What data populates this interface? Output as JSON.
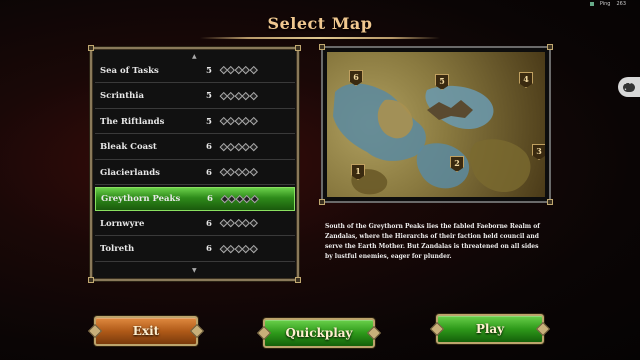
{
  "header": {
    "title": "Select Map",
    "ping_label": "Ping",
    "ping_value": "263"
  },
  "map_list": {
    "scroll_up_icon": "▲",
    "scroll_down_icon": "▼",
    "rows": [
      {
        "name": "Sea of Tasks",
        "players": "5",
        "rating": 5,
        "selected": false
      },
      {
        "name": "Scrinthia",
        "players": "5",
        "rating": 5,
        "selected": false
      },
      {
        "name": "The Riftlands",
        "players": "5",
        "rating": 5,
        "selected": false
      },
      {
        "name": "Bleak Coast",
        "players": "6",
        "rating": 5,
        "selected": false
      },
      {
        "name": "Glacierlands",
        "players": "6",
        "rating": 5,
        "selected": false
      },
      {
        "name": "Greythorn Peaks",
        "players": "6",
        "rating": 5,
        "selected": true
      },
      {
        "name": "Lornwyre",
        "players": "6",
        "rating": 5,
        "selected": false
      },
      {
        "name": "Tolreth",
        "players": "6",
        "rating": 5,
        "selected": false
      }
    ]
  },
  "preview": {
    "region_labels": [
      "6",
      "5",
      "4",
      "1",
      "2",
      "3"
    ]
  },
  "description": "South of the Greythorn Peaks lies the fabled Faeborne Realm of Zandalas, where the Hierarchs of their faction held council and serve the Earth Mother. But Zandalas is threatened on all sides by lustful enemies, eager for plunder.",
  "buttons": {
    "exit": "Exit",
    "quickplay": "Quickplay",
    "play": "Play"
  },
  "colors": {
    "selected_row": "#2e8a1a",
    "exit_button": "#b05a18",
    "action_button": "#2e9a1a",
    "title": "#f0c890"
  }
}
